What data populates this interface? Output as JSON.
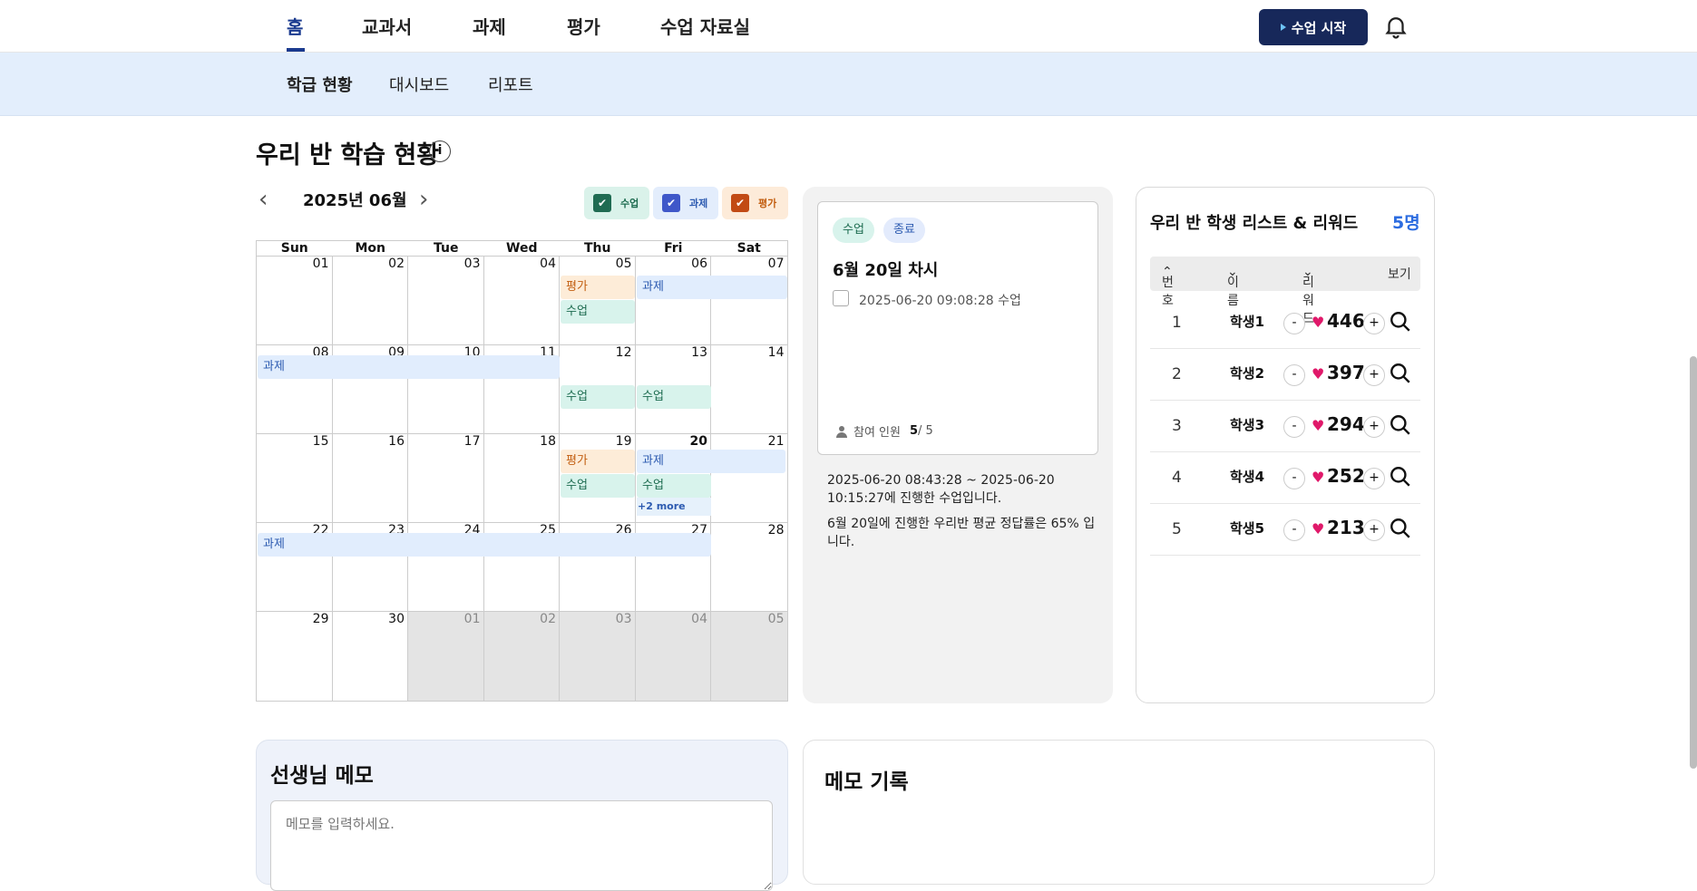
{
  "top_nav": {
    "tabs": [
      "홈",
      "교과서",
      "과제",
      "평가",
      "수업 자료실"
    ],
    "start_button": "수업 시작"
  },
  "sub_nav": {
    "tabs": [
      "학급 현황",
      "대시보드",
      "리포트"
    ]
  },
  "section_title": "우리 반 학습 현황",
  "calendar": {
    "month_label": "2025년 06월",
    "filters": [
      {
        "label": "수업",
        "color": "#1f6b52",
        "bg": "#daf2ea",
        "text": "#1c6b4f"
      },
      {
        "label": "과제",
        "color": "#3f57c9",
        "bg": "#e3edfc",
        "text": "#2c5ab0"
      },
      {
        "label": "평가",
        "color": "#c24a14",
        "bg": "#fdebd9",
        "text": "#c25e10"
      }
    ],
    "weekdays": [
      "Sun",
      "Mon",
      "Tue",
      "Wed",
      "Thu",
      "Fri",
      "Sat"
    ],
    "weeks": [
      [
        "01",
        "02",
        "03",
        "04",
        "05",
        "06",
        "07"
      ],
      [
        "08",
        "09",
        "10",
        "11",
        "12",
        "13",
        "14"
      ],
      [
        "15",
        "16",
        "17",
        "18",
        "19",
        "20",
        "21"
      ],
      [
        "22",
        "23",
        "24",
        "25",
        "26",
        "27",
        "28"
      ],
      [
        "29",
        "30",
        "01",
        "02",
        "03",
        "04",
        "05"
      ]
    ],
    "today": "20",
    "events": {
      "w1_pg": "평가",
      "w1_sg": "수업",
      "w1_gj": "과제",
      "w2_gj": "과제",
      "w2_sg1": "수업",
      "w2_sg2": "수업",
      "w3_pg": "평가",
      "w3_gj": "과제",
      "w3_sg1": "수업",
      "w3_sg2": "수업",
      "w3_more": "+2 more",
      "w4_gj": "과제"
    }
  },
  "lesson_card": {
    "chip_class": "수업",
    "chip_status": "종료",
    "title": "6월 20일 차시",
    "datetime": "2025-06-20 09:08:28 수업",
    "participants_label": "참여 인원",
    "participants_current": "5",
    "participants_total": "/ 5"
  },
  "lesson_summary": {
    "line1": "2025-06-20 08:43:28 ~ 2025-06-20 10:15:27에 진행한 수업입니다.",
    "line2": "6월 20일에 진행한 우리반 평균 정답률은 65% 입니다."
  },
  "students": {
    "title": "우리 반 학생 리스트 & 리워드",
    "count": "5명",
    "headers": {
      "no": "번호",
      "name": "이름",
      "reward": "리워드",
      "view": "보기"
    },
    "rows": [
      {
        "no": "1",
        "name": "학생1",
        "score": "446"
      },
      {
        "no": "2",
        "name": "학생2",
        "score": "397"
      },
      {
        "no": "3",
        "name": "학생3",
        "score": "294"
      },
      {
        "no": "4",
        "name": "학생4",
        "score": "252"
      },
      {
        "no": "5",
        "name": "학생5",
        "score": "213"
      }
    ],
    "minus": "-",
    "plus": "+"
  },
  "memo": {
    "title": "선생님 메모",
    "placeholder": "메모를 입력하세요."
  },
  "memo_log": {
    "title": "메모 기록"
  }
}
